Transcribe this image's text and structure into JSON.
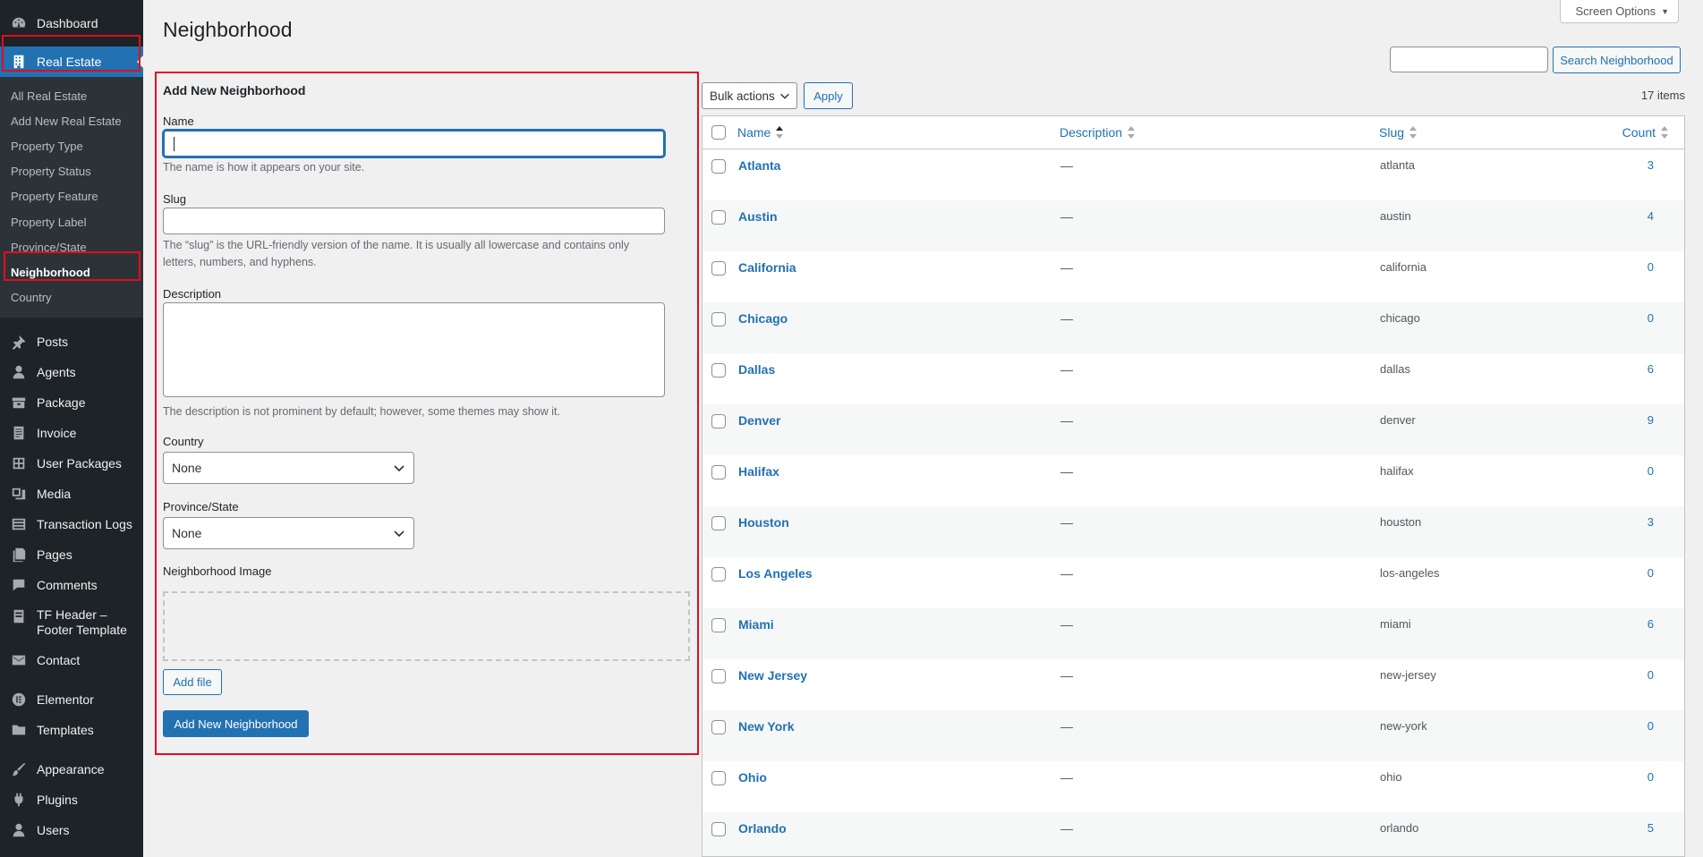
{
  "sidebar": {
    "top_items": [
      {
        "label": "Dashboard",
        "icon": "dashboard-icon"
      },
      {
        "label": "Real Estate",
        "icon": "building-icon"
      }
    ],
    "submenu": [
      {
        "label": "All Real Estate"
      },
      {
        "label": "Add New Real Estate"
      },
      {
        "label": "Property Type"
      },
      {
        "label": "Property Status"
      },
      {
        "label": "Property Feature"
      },
      {
        "label": "Property Label"
      },
      {
        "label": "Province/State"
      },
      {
        "label": "Neighborhood"
      },
      {
        "label": "Country"
      }
    ],
    "items": [
      {
        "label": "Posts",
        "icon": "pushpin-icon"
      },
      {
        "label": "Agents",
        "icon": "user-icon"
      },
      {
        "label": "Package",
        "icon": "package-icon"
      },
      {
        "label": "Invoice",
        "icon": "invoice-icon"
      },
      {
        "label": "User Packages",
        "icon": "user-packages-icon"
      },
      {
        "label": "Media",
        "icon": "media-icon"
      },
      {
        "label": "Transaction Logs",
        "icon": "list-icon"
      },
      {
        "label": "Pages",
        "icon": "pages-icon"
      },
      {
        "label": "Comments",
        "icon": "comments-icon"
      },
      {
        "label": "TF Header –",
        "label2": "Footer Template",
        "icon": "page-icon"
      },
      {
        "label": "Contact",
        "icon": "mail-icon"
      },
      {
        "label": "Elementor",
        "icon": "elementor-icon"
      },
      {
        "label": "Templates",
        "icon": "folder-icon"
      },
      {
        "label": "Appearance",
        "icon": "brush-icon"
      },
      {
        "label": "Plugins",
        "icon": "plug-icon"
      },
      {
        "label": "Users",
        "icon": "users-icon"
      }
    ]
  },
  "header": {
    "title": "Neighborhood",
    "screen_options": "Screen Options",
    "search_button": "Search Neighborhood",
    "search_value": ""
  },
  "form": {
    "heading": "Add New Neighborhood",
    "name_label": "Name",
    "name_desc": "The name is how it appears on your site.",
    "slug_label": "Slug",
    "slug_desc_1": "The “slug” is the URL-friendly version of the name. It is usually all lowercase and contains only",
    "slug_desc_2": "letters, numbers, and hyphens.",
    "description_label": "Description",
    "description_desc": "The description is not prominent by default; however, some themes may show it.",
    "country_label": "Country",
    "country_value": "None",
    "province_label": "Province/State",
    "province_value": "None",
    "image_label": "Neighborhood Image",
    "add_file": "Add file",
    "submit": "Add New Neighborhood"
  },
  "table": {
    "bulk_actions": "Bulk actions",
    "apply": "Apply",
    "items_count": "17 items",
    "columns": {
      "name": "Name",
      "description": "Description",
      "slug": "Slug",
      "count": "Count"
    },
    "rows": [
      {
        "name": "Atlanta",
        "desc": "—",
        "slug": "atlanta",
        "count": "3"
      },
      {
        "name": "Austin",
        "desc": "—",
        "slug": "austin",
        "count": "4"
      },
      {
        "name": "California",
        "desc": "—",
        "slug": "california",
        "count": "0"
      },
      {
        "name": "Chicago",
        "desc": "—",
        "slug": "chicago",
        "count": "0"
      },
      {
        "name": "Dallas",
        "desc": "—",
        "slug": "dallas",
        "count": "6"
      },
      {
        "name": "Denver",
        "desc": "—",
        "slug": "denver",
        "count": "9"
      },
      {
        "name": "Halifax",
        "desc": "—",
        "slug": "halifax",
        "count": "0"
      },
      {
        "name": "Houston",
        "desc": "—",
        "slug": "houston",
        "count": "3"
      },
      {
        "name": "Los Angeles",
        "desc": "—",
        "slug": "los-angeles",
        "count": "0"
      },
      {
        "name": "Miami",
        "desc": "—",
        "slug": "miami",
        "count": "6"
      },
      {
        "name": "New Jersey",
        "desc": "—",
        "slug": "new-jersey",
        "count": "0"
      },
      {
        "name": "New York",
        "desc": "—",
        "slug": "new-york",
        "count": "0"
      },
      {
        "name": "Ohio",
        "desc": "—",
        "slug": "ohio",
        "count": "0"
      },
      {
        "name": "Orlando",
        "desc": "—",
        "slug": "orlando",
        "count": "5"
      }
    ]
  },
  "colors": {
    "accent": "#2271b1",
    "sidebar": "#1d2327",
    "highlight": "#e20d1e"
  }
}
